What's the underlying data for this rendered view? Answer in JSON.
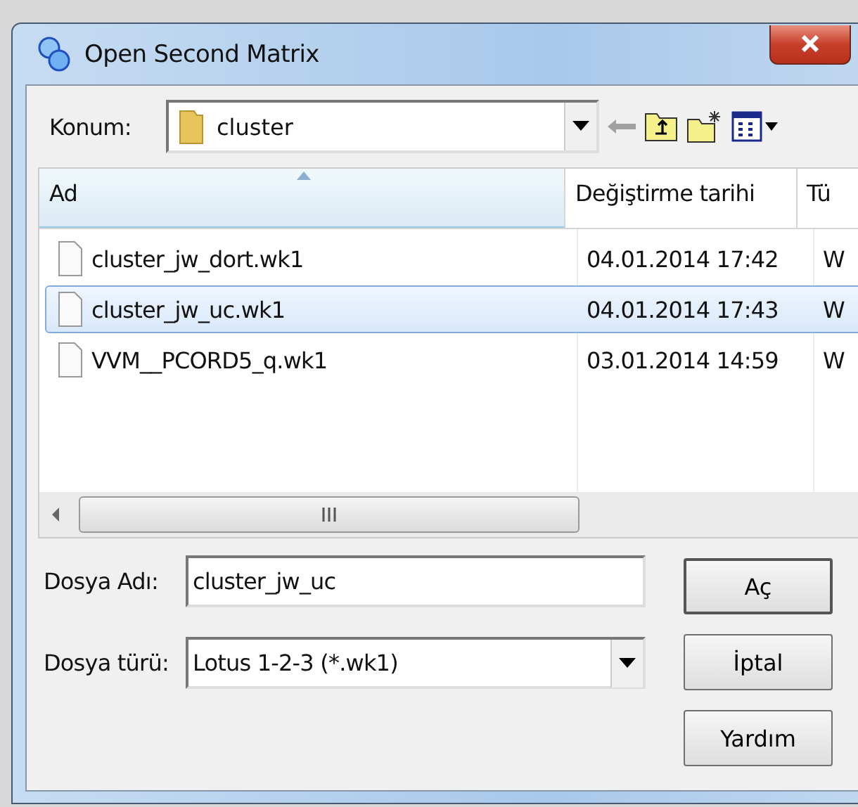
{
  "window": {
    "title": "Open Second Matrix"
  },
  "location": {
    "label": "Konum:",
    "value": "cluster"
  },
  "file_list": {
    "columns": [
      {
        "label": "Ad",
        "sorted": true
      },
      {
        "label": "Değiştirme tarihi",
        "sorted": false
      },
      {
        "label": "Tü",
        "sorted": false
      }
    ],
    "rows": [
      {
        "name": "cluster_jw_dort.wk1",
        "modified": "04.01.2014 17:42",
        "column_3": "W",
        "selected": false
      },
      {
        "name": "cluster_jw_uc.wk1",
        "modified": "04.01.2014 17:43",
        "column_3": "W",
        "selected": true
      },
      {
        "name": "VVM__PCORD5_q.wk1",
        "modified": "03.01.2014 14:59",
        "column_3": "W",
        "selected": false
      }
    ]
  },
  "file_name": {
    "label": "Dosya Adı:",
    "value": "cluster_jw_uc"
  },
  "file_type": {
    "label": "Dosya türü:",
    "value": "Lotus 1-2-3 (*.wk1)"
  },
  "buttons": [
    "Aç",
    "İptal",
    "Yardım"
  ]
}
